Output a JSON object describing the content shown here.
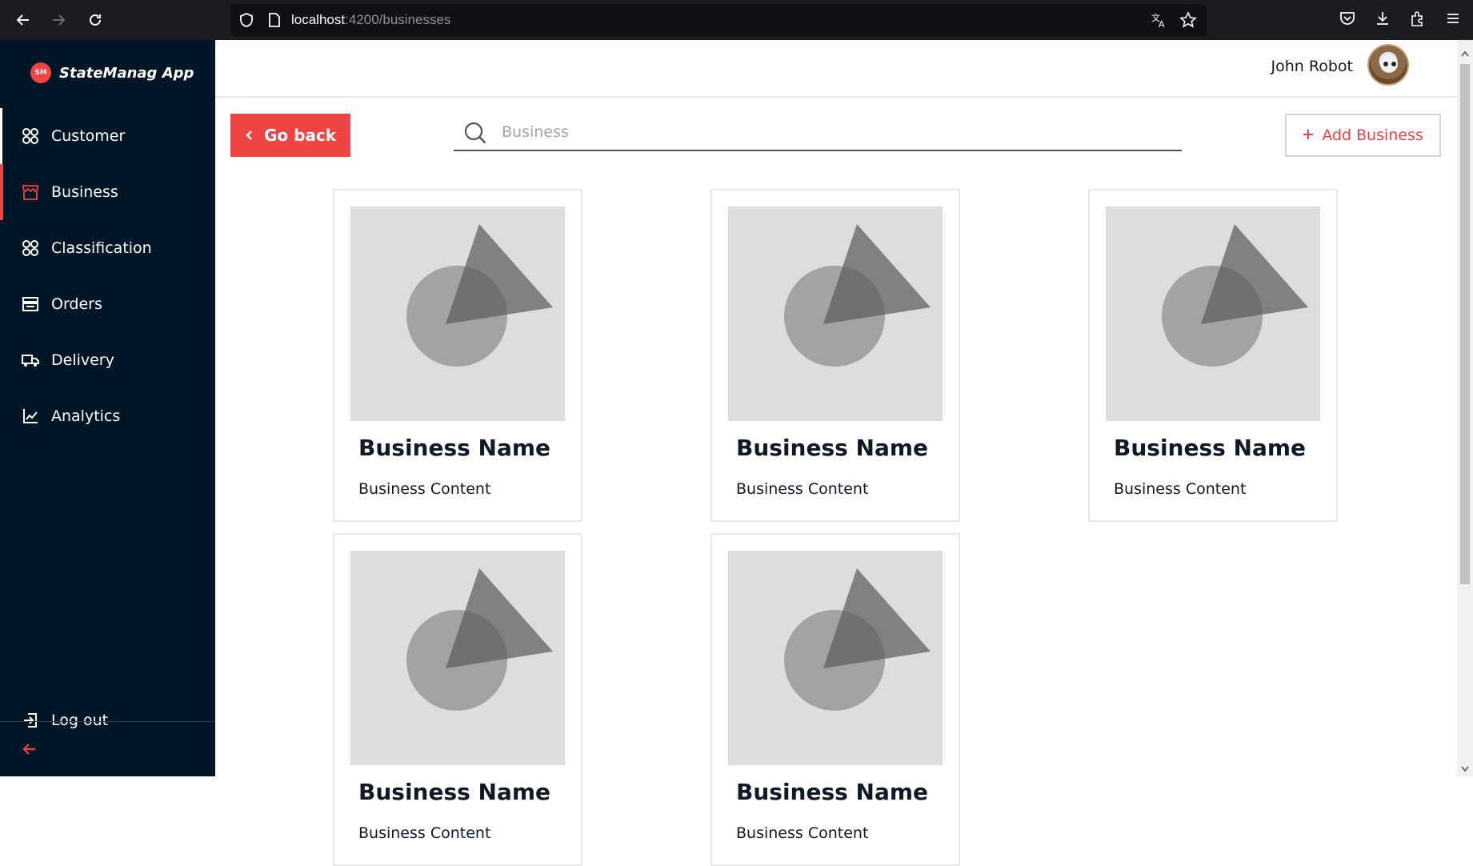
{
  "browser": {
    "url_host": "localhost",
    "url_path": ":4200/businesses"
  },
  "sidebar": {
    "brand_badge": "SM",
    "brand_name": "StateManag App",
    "items": [
      {
        "label": "Customer",
        "icon": "grid-icon"
      },
      {
        "label": "Business",
        "icon": "store-icon"
      },
      {
        "label": "Classification",
        "icon": "grid-icon"
      },
      {
        "label": "Orders",
        "icon": "cash-register-icon"
      },
      {
        "label": "Delivery",
        "icon": "truck-icon"
      },
      {
        "label": "Analytics",
        "icon": "chart-line-icon"
      }
    ],
    "logout_label": "Log out",
    "active_item": "Business"
  },
  "header": {
    "user_name": "John Robot"
  },
  "toolbar": {
    "go_back_label": "Go back",
    "search_placeholder": "Business",
    "add_business_label": "Add Business"
  },
  "cards": [
    {
      "title": "Business Name",
      "content": "Business Content"
    },
    {
      "title": "Business Name",
      "content": "Business Content"
    },
    {
      "title": "Business Name",
      "content": "Business Content"
    },
    {
      "title": "Business Name",
      "content": "Business Content"
    },
    {
      "title": "Business Name",
      "content": "Business Content"
    }
  ],
  "colors": {
    "accent": "#ef4444",
    "sidebar_bg": "#001525"
  }
}
